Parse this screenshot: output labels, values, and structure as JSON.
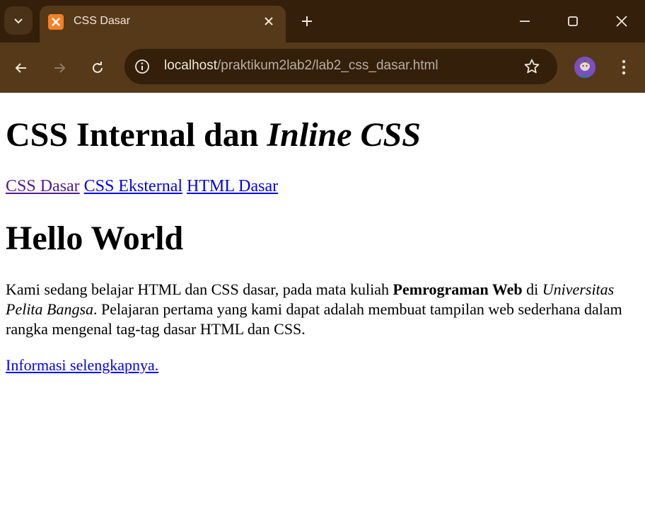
{
  "browser": {
    "tab": {
      "title": "CSS Dasar",
      "favicon": "xampp-icon"
    },
    "address": {
      "host": "localhost",
      "path": "/praktikum2lab2/lab2_css_dasar.html"
    },
    "colors": {
      "frame": "#331f0a",
      "toolbar": "#553919",
      "text": "#f1e7dc"
    }
  },
  "page": {
    "title_main": "CSS Internal dan ",
    "title_italic": "Inline CSS",
    "links": [
      "CSS Dasar",
      "CSS Eksternal",
      "HTML Dasar"
    ],
    "heading": "Hello World",
    "para": {
      "p1": "Kami sedang belajar HTML dan CSS dasar, pada mata kuliah ",
      "bold": "Pemrograman Web",
      "p2": " di ",
      "italic": "Universitas Pelita Bangsa",
      "p3": ". Pelajaran pertama yang kami dapat adalah membuat tampilan web sederhana dalam rangka mengenal tag-tag dasar HTML dan CSS."
    },
    "more_link": "Informasi selengkapnya.",
    "colors": {
      "link": "#0000ee",
      "visited": "#551a8b"
    }
  }
}
